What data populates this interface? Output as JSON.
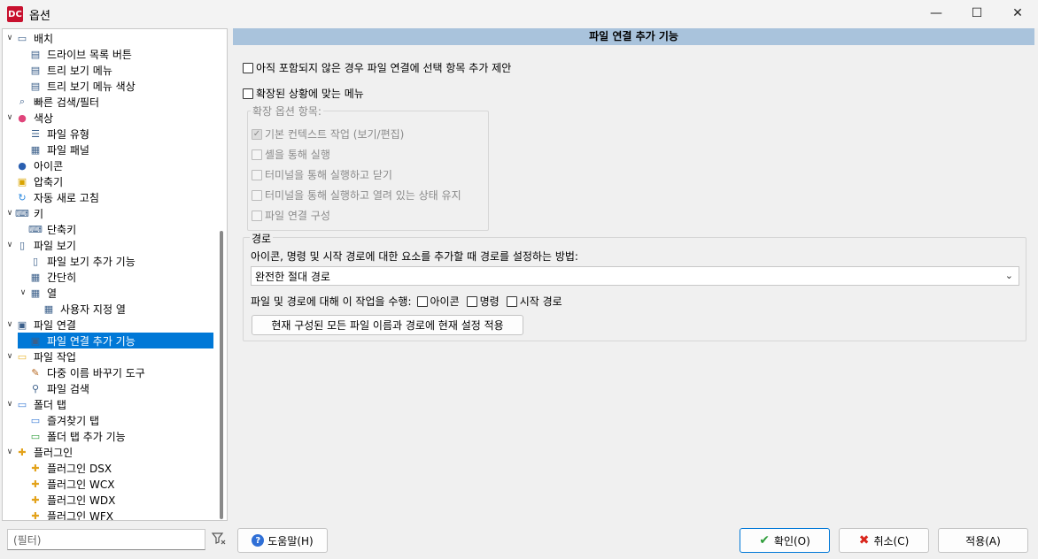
{
  "window": {
    "title": "옵션",
    "app_badge": "DC"
  },
  "tree": {
    "items": [
      {
        "label": "배치",
        "icon": "layout-icon"
      },
      {
        "label": "드라이브 목록 버튼",
        "icon": "drive-list-icon"
      },
      {
        "label": "트리 보기 메뉴",
        "icon": "tree-menu-icon"
      },
      {
        "label": "트리 보기 메뉴 색상",
        "icon": "tree-menu-color-icon"
      },
      {
        "label": "빠른 검색/필터",
        "icon": "quick-search-icon"
      },
      {
        "label": "색상",
        "icon": "color-wheel-icon"
      },
      {
        "label": "파일 유형",
        "icon": "file-type-icon"
      },
      {
        "label": "파일 패널",
        "icon": "file-panel-icon"
      },
      {
        "label": "아이콘",
        "icon": "icons-icon"
      },
      {
        "label": "압축기",
        "icon": "archiver-icon"
      },
      {
        "label": "자동 새로 고침",
        "icon": "refresh-icon"
      },
      {
        "label": "키",
        "icon": "keyboard-icon"
      },
      {
        "label": "단축키",
        "icon": "hotkey-icon"
      },
      {
        "label": "파일 보기",
        "icon": "file-view-icon"
      },
      {
        "label": "파일 보기 추가 기능",
        "icon": "file-view-extra-icon"
      },
      {
        "label": "간단히",
        "icon": "brief-icon"
      },
      {
        "label": "열",
        "icon": "columns-icon"
      },
      {
        "label": "사용자 지정 열",
        "icon": "custom-columns-icon"
      },
      {
        "label": "파일 연결",
        "icon": "file-assoc-icon"
      },
      {
        "label": "파일 연결 추가 기능",
        "icon": "file-assoc-extra-icon"
      },
      {
        "label": "파일 작업",
        "icon": "file-ops-icon"
      },
      {
        "label": "다중 이름 바꾸기 도구",
        "icon": "multi-rename-icon"
      },
      {
        "label": "파일 검색",
        "icon": "binoculars-icon"
      },
      {
        "label": "폴더 탭",
        "icon": "folder-tabs-icon"
      },
      {
        "label": "즐겨찾기 탭",
        "icon": "favorite-tabs-icon"
      },
      {
        "label": "폴더 탭 추가 기능",
        "icon": "folder-tabs-extra-icon"
      },
      {
        "label": "플러그인",
        "icon": "plugin-icon"
      },
      {
        "label": "플러그인 DSX",
        "icon": "plugin-dsx-icon"
      },
      {
        "label": "플러그인 WCX",
        "icon": "plugin-wcx-icon"
      },
      {
        "label": "플러그인 WDX",
        "icon": "plugin-wdx-icon"
      },
      {
        "label": "플러그인 WFX",
        "icon": "plugin-wfx-icon"
      }
    ],
    "selected": "파일 연결 추가 기능"
  },
  "filter": {
    "placeholder": "(필터)"
  },
  "panel": {
    "title": "파일 연결 추가 기능",
    "opt_offer": "아직 포함되지 않은 경우 파일 연결에 선택 항목 추가 제안",
    "opt_extended": "확장된 상황에 맞는 메뉴",
    "extended_group_title": "확장 옵션 항목:",
    "extended_items": [
      {
        "label": "기본 컨텍스트 작업 (보기/편집)",
        "checked": true
      },
      {
        "label": "셸을 통해 실행",
        "checked": false
      },
      {
        "label": "터미널을 통해 실행하고 닫기",
        "checked": false
      },
      {
        "label": "터미널을 통해 실행하고 열려 있는 상태 유지",
        "checked": false
      },
      {
        "label": "파일 연결 구성",
        "checked": false
      }
    ],
    "path_group_title": "경로",
    "path_desc": "아이콘, 명령 및 시작 경로에 대한 요소를 추가할 때 경로를 설정하는 방법:",
    "path_select_value": "완전한 절대 경로",
    "apply_to_label": "파일 및 경로에 대해 이 작업을 수행:",
    "apply_icon": "아이콘",
    "apply_command": "명령",
    "apply_start": "시작 경로",
    "apply_all_button": "현재 구성된 모든 파일 이름과 경로에 현재 설정 적용"
  },
  "buttons": {
    "help": "도움말(H)",
    "ok": "확인(O)",
    "cancel": "취소(C)",
    "apply": "적용(A)"
  }
}
